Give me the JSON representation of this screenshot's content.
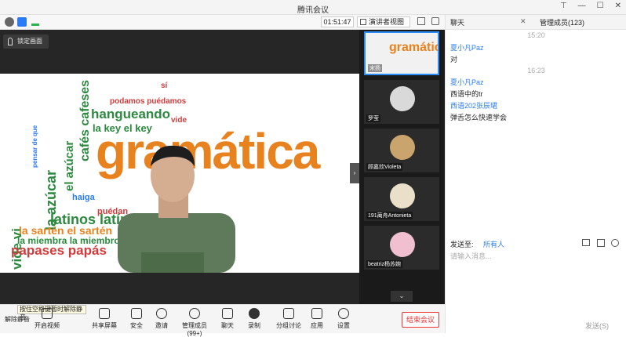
{
  "window": {
    "title": "腾讯会议"
  },
  "infobar": {
    "timer": "01:51:47",
    "view_label": "演讲者视图"
  },
  "main": {
    "lock_label": "锁定画面",
    "slide": {
      "big_word": "gramática",
      "words": [
        "vide vi",
        "la azúcar",
        "el azúcar",
        "papases papás",
        "la sartén el sartén",
        "la miembra la miembro",
        "hangueando",
        "cafés cafeses",
        "latinos latín",
        "la key el key",
        "podamos puédamos",
        "haiga",
        "sí",
        "pensar de que",
        "puédan",
        "vide"
      ]
    }
  },
  "thumbnails": [
    {
      "name": "宋扬",
      "active": true
    },
    {
      "name": "罗莹",
      "active": false
    },
    {
      "name": "顾嘉欣Violeta",
      "active": false
    },
    {
      "name": "191蔺舟Antonieta",
      "active": false
    },
    {
      "name": "beatriz杨苏婉",
      "active": false
    }
  ],
  "chat": {
    "tab_chat": "聊天",
    "tab_members": "管理成员(123)",
    "messages": [
      {
        "time": "15:20"
      },
      {
        "sender": "夏小凡Paz",
        "text": "对"
      },
      {
        "time": "16:23"
      },
      {
        "sender": "夏小凡Paz",
        "text": "西语中的tr"
      },
      {
        "sender": "西语202张辰珺",
        "text": "弹舌怎么快速学会"
      }
    ],
    "send_to_label": "发送至:",
    "send_to_value": "所有人",
    "input_placeholder": "请输入消息...",
    "send_label": "发送(S)"
  },
  "toolbar": {
    "tooltip": "按住空格键暂时解除静音",
    "items": [
      "解除静音",
      "开启视频",
      "共享屏幕",
      "安全",
      "邀请",
      "管理成员(99+)",
      "聊天",
      "录制",
      "分组讨论",
      "应用",
      "设置"
    ],
    "end_label": "结束会议"
  }
}
